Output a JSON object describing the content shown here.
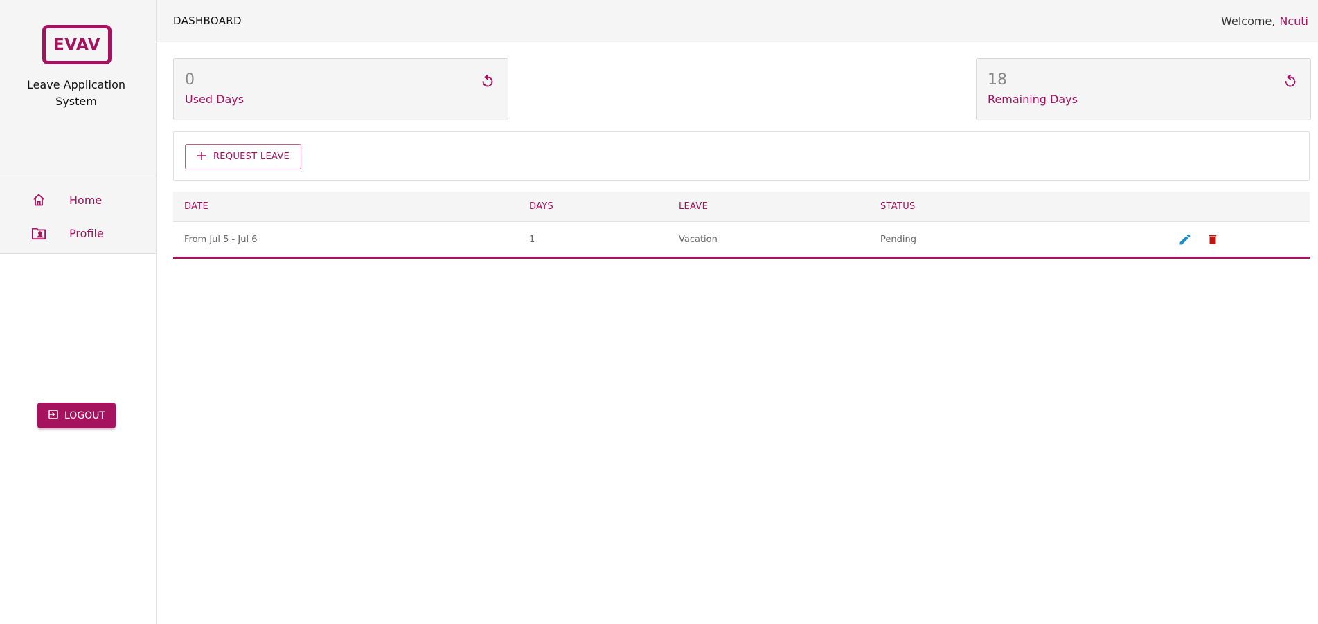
{
  "sidebar": {
    "logo_text": "EVAV",
    "app_title": "Leave Application System",
    "nav": [
      {
        "label": "Home",
        "icon": "home-icon"
      },
      {
        "label": "Profile",
        "icon": "profile-folder-icon"
      }
    ],
    "logout_label": "LOGOUT"
  },
  "header": {
    "title": "DASHBOARD",
    "welcome_text": "Welcome,",
    "username": "Ncuti"
  },
  "stats": {
    "used": {
      "value": "0",
      "label": "Used Days"
    },
    "remaining": {
      "value": "18",
      "label": "Remaining Days"
    }
  },
  "toolbar": {
    "request_label": "REQUEST LEAVE"
  },
  "table": {
    "headers": {
      "date": "DATE",
      "days": "DAYS",
      "leave": "LEAVE",
      "status": "STATUS"
    },
    "rows": [
      {
        "date": "From Jul 5 - Jul 6",
        "days": "1",
        "leave": "Vacation",
        "status": "Pending"
      }
    ]
  },
  "colors": {
    "accent": "#a5135f",
    "edit": "#1a8fc4",
    "delete": "#c0150f"
  }
}
